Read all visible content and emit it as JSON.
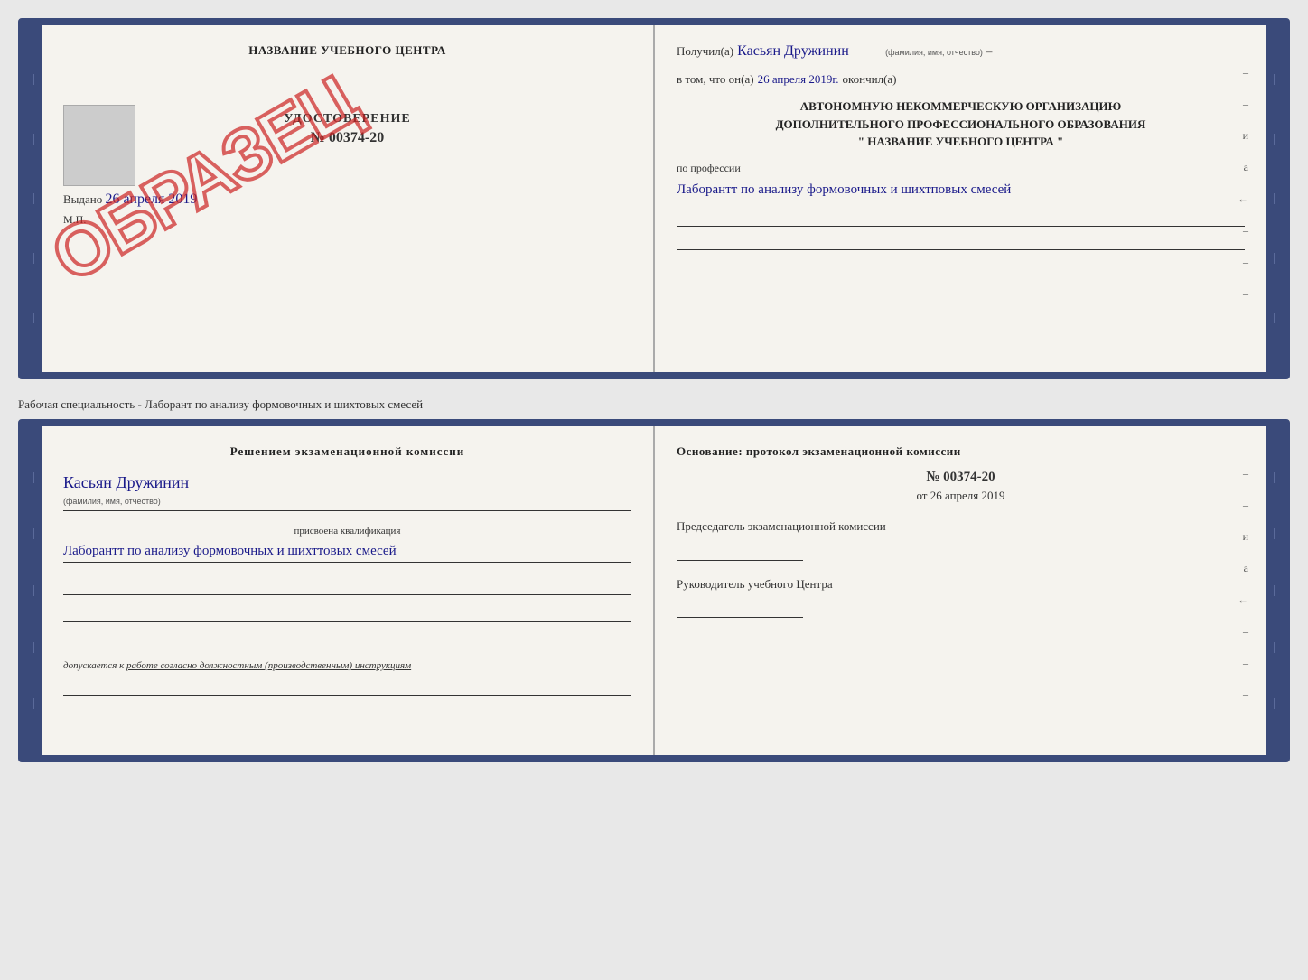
{
  "page": {
    "background": "#e8e8e8"
  },
  "top_document": {
    "left": {
      "title": "НАЗВАНИЕ УЧЕБНОГО ЦЕНТРА",
      "cert_type": "УДОСТОВЕРЕНИЕ",
      "cert_number": "№ 00374-20",
      "issued_label": "Выдано",
      "issued_date": "26 апреля 2019",
      "mp_label": "М.П.",
      "stamp_text": "ОБРАЗЕЦ"
    },
    "right": {
      "received_label": "Получил(а)",
      "recipient_name": "Касьян Дружинин",
      "fio_sublabel": "(фамилия, имя, отчество)",
      "date_prefix": "в том, что он(а)",
      "date_value": "26 апреля 2019г.",
      "date_suffix": "окончил(а)",
      "org_line1": "АВТОНОМНУЮ НЕКОММЕРЧЕСКУЮ ОРГАНИЗАЦИЮ",
      "org_line2": "ДОПОЛНИТЕЛЬНОГО ПРОФЕССИОНАЛЬНОГО ОБРАЗОВАНИЯ",
      "org_name": "\"  НАЗВАНИЕ УЧЕБНОГО ЦЕНТРА  \"",
      "profession_label": "по профессии",
      "profession_text": "Лаборантт по анализу формовочных и шихтповых смесей",
      "right_marks": [
        "-",
        "-",
        "-",
        "и",
        "а",
        "←",
        "-",
        "-",
        "-"
      ]
    }
  },
  "middle_label": "Рабочая специальность - Лаборант по анализу формовочных и шихтовых смесей",
  "bottom_document": {
    "left": {
      "decision_title": "Решением экзаменационной комиссии",
      "name_handwritten": "Касьян Дружинин",
      "fio_sublabel": "(фамилия, имя, отчество)",
      "qualification_label": "присвоена квалификация",
      "qualification_text": "Лаборантт по анализу формовочных и шихттовых смесей",
      "admission_prefix": "допускается к",
      "admission_text": "работе согласно должностным (производственным) инструкциям"
    },
    "right": {
      "foundation_title": "Основание: протокол экзаменационной комиссии",
      "protocol_number": "№ 00374-20",
      "protocol_date_prefix": "от",
      "protocol_date": "26 апреля 2019",
      "chairman_label": "Председатель экзаменационной комиссии",
      "head_label": "Руководитель учебного Центра",
      "right_marks": [
        "-",
        "-",
        "-",
        "и",
        "а",
        "←",
        "-",
        "-",
        "-"
      ]
    }
  }
}
